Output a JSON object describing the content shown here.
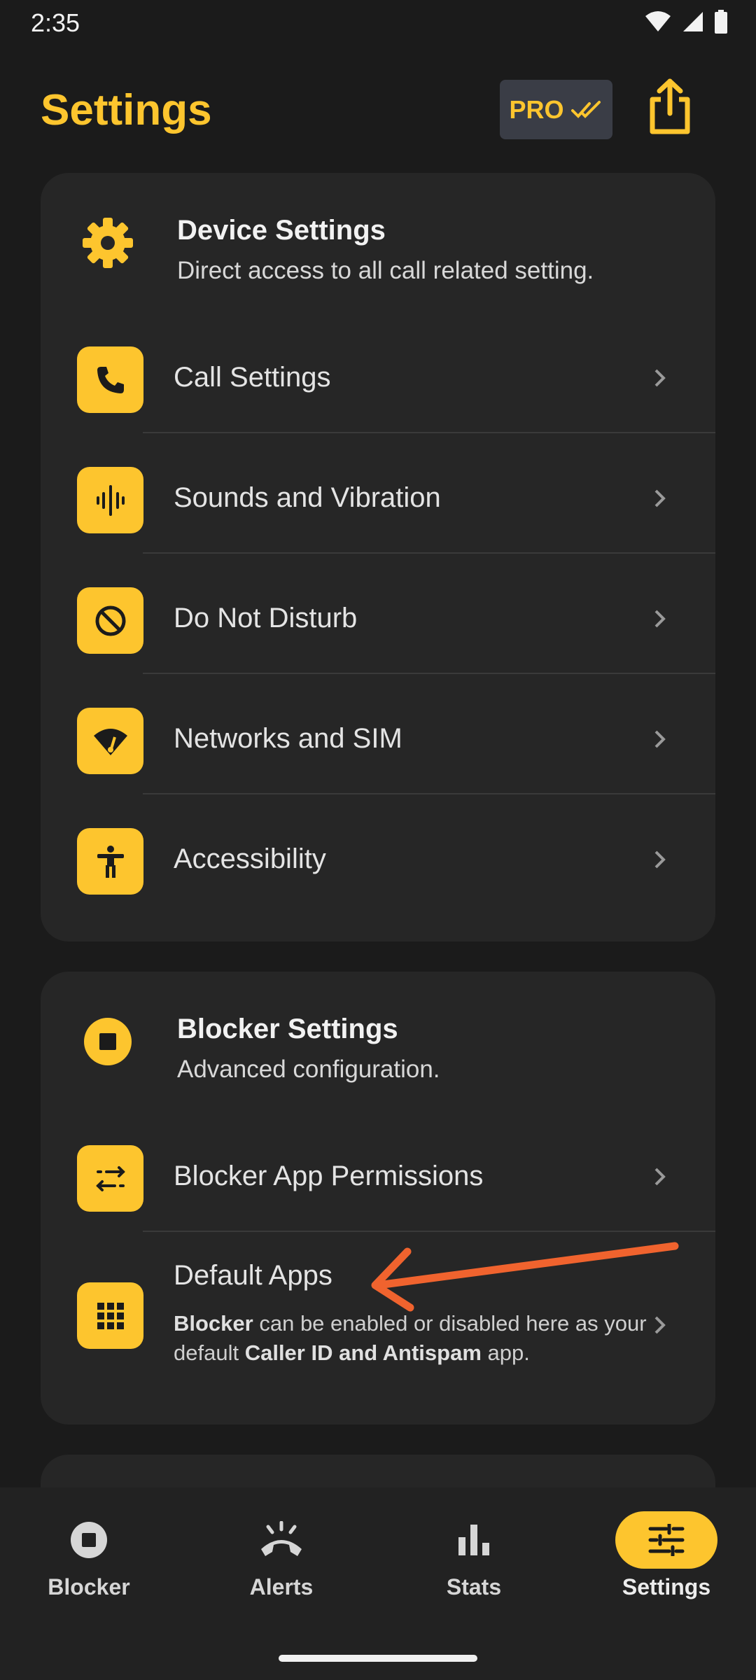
{
  "status_bar": {
    "time": "2:35"
  },
  "header": {
    "title": "Settings",
    "pro_label": "PRO"
  },
  "device_card": {
    "title": "Device Settings",
    "subtitle": "Direct access to all call related setting.",
    "items": [
      {
        "label": "Call Settings",
        "icon": "phone-icon"
      },
      {
        "label": "Sounds and Vibration",
        "icon": "sound-wave-icon"
      },
      {
        "label": "Do Not Disturb",
        "icon": "do-not-disturb-icon"
      },
      {
        "label": "Networks and SIM",
        "icon": "network-icon"
      },
      {
        "label": "Accessibility",
        "icon": "accessibility-icon"
      }
    ]
  },
  "blocker_card": {
    "title": "Blocker Settings",
    "subtitle": "Advanced configuration.",
    "items": [
      {
        "label": "Blocker App Permissions",
        "icon": "swap-arrows-icon"
      },
      {
        "label": "Default Apps",
        "icon": "app-grid-icon",
        "desc_bold_1": "Blocker",
        "desc_text_1": " can be enabled or disabled here as your default ",
        "desc_bold_2": "Caller ID and Antispam",
        "desc_text_2": " app."
      }
    ]
  },
  "bottom_nav": {
    "items": [
      {
        "label": "Blocker",
        "icon": "stop-circle-icon"
      },
      {
        "label": "Alerts",
        "icon": "call-end-icon"
      },
      {
        "label": "Stats",
        "icon": "bar-chart-icon"
      },
      {
        "label": "Settings",
        "icon": "sliders-icon",
        "active": true
      }
    ]
  },
  "colors": {
    "accent": "#fdc52e",
    "background": "#1b1b1b",
    "card": "#262626",
    "annotation": "#f0632e"
  }
}
